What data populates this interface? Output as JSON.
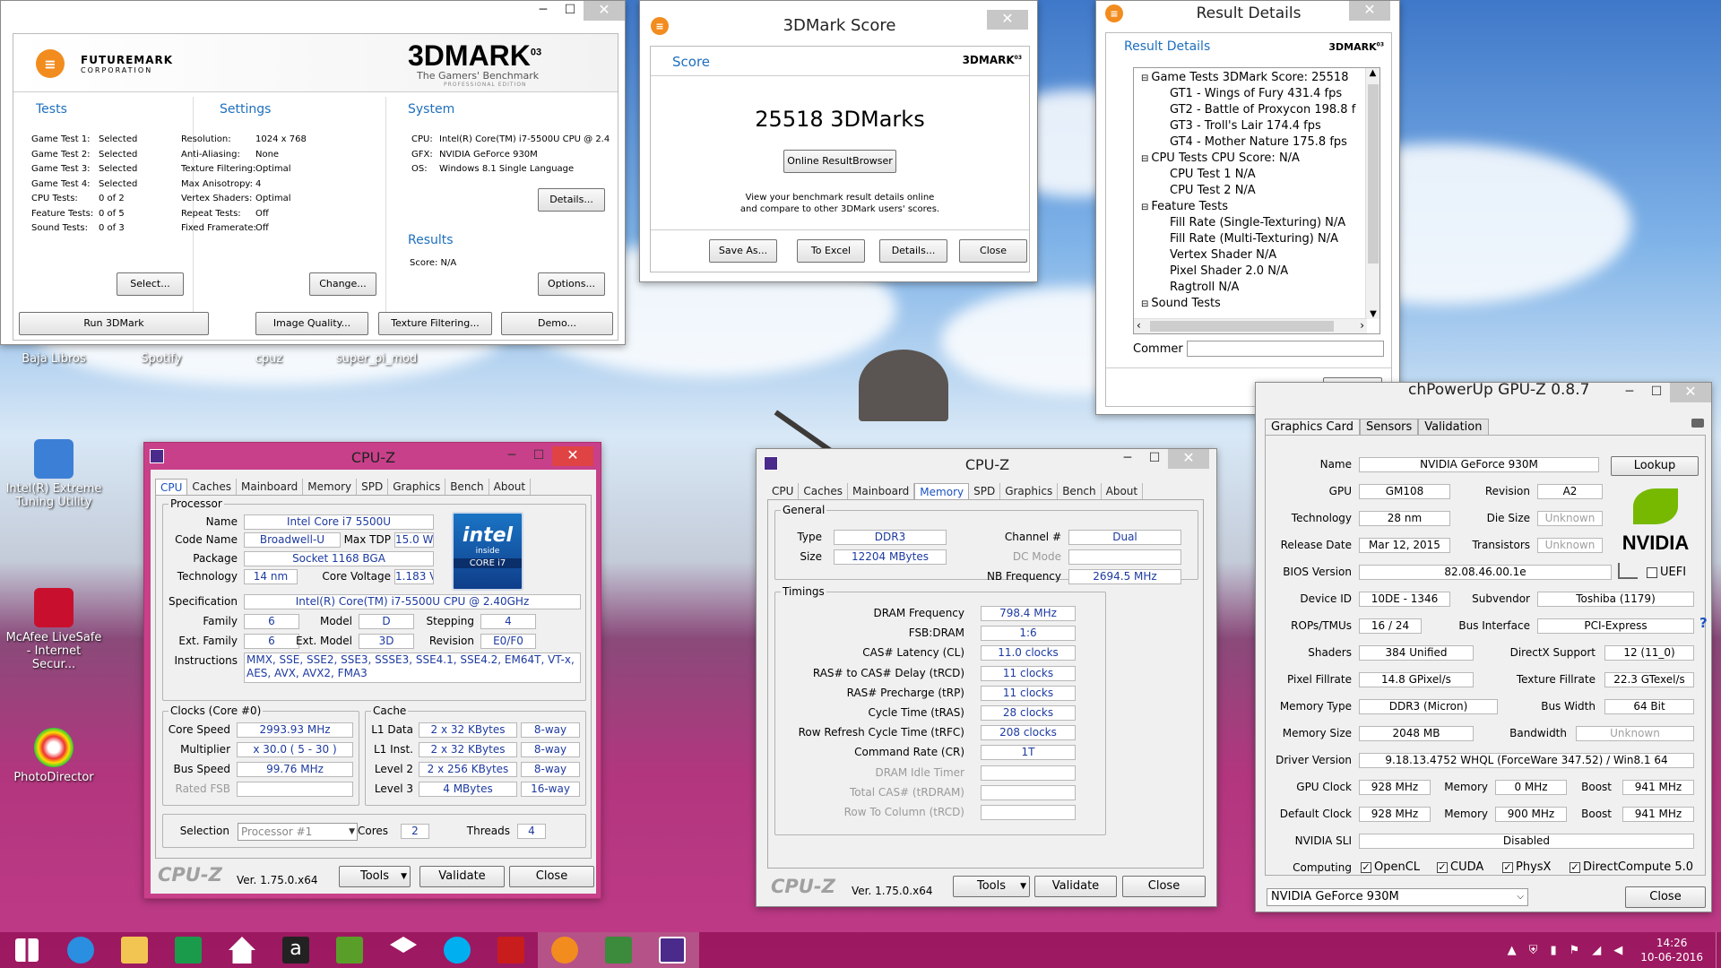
{
  "tdm": {
    "logo_line1": "FUTUREMARK",
    "logo_line2": "CORPORATION",
    "brand": "3DMARK",
    "brand_sup": "03",
    "tagline": "The Gamers' Benchmark",
    "edition": "PROFESSIONAL EDITION",
    "tests_title": "Tests",
    "settings_title": "Settings",
    "system_title": "System",
    "results_title": "Results",
    "tests": [
      [
        "Game Test 1:",
        "Selected"
      ],
      [
        "Game Test 2:",
        "Selected"
      ],
      [
        "Game Test 3:",
        "Selected"
      ],
      [
        "Game Test 4:",
        "Selected"
      ],
      [
        "CPU Tests:",
        "0 of 2"
      ],
      [
        "Feature Tests:",
        "0 of 5"
      ],
      [
        "Sound Tests:",
        "0 of 3"
      ]
    ],
    "settings": [
      [
        "Resolution:",
        "1024 x 768"
      ],
      [
        "Anti-Aliasing:",
        "None"
      ],
      [
        "Texture Filtering:",
        "Optimal"
      ],
      [
        "Max Anisotropy:",
        "4"
      ],
      [
        "Vertex Shaders:",
        "Optimal"
      ],
      [
        "Repeat Tests:",
        "Off"
      ],
      [
        "Fixed Framerate:",
        "Off"
      ]
    ],
    "system": [
      [
        "CPU:",
        "Intel(R) Core(TM) i7-5500U CPU @ 2.40"
      ],
      [
        "GFX:",
        "NVIDIA GeForce 930M"
      ],
      [
        "OS:",
        "Windows 8.1 Single Language"
      ]
    ],
    "results_score": "Score: N/A",
    "btn_details": "Details...",
    "btn_select": "Select...",
    "btn_change": "Change...",
    "btn_options": "Options...",
    "btn_run": "Run 3DMark",
    "btn_iq": "Image Quality...",
    "btn_tf": "Texture Filtering...",
    "btn_demo": "Demo..."
  },
  "score": {
    "window_title": "3DMark Score",
    "header": "Score",
    "brand": "3DMARK",
    "brand_sup": "03",
    "value": "25518 3DMarks",
    "btn_online": "Online ResultBrowser",
    "desc1": "View your benchmark result details online",
    "desc2": "and compare to other 3DMark users' scores.",
    "btn_save": "Save As...",
    "btn_excel": "To Excel",
    "btn_details": "Details...",
    "btn_close": "Close"
  },
  "result": {
    "window_title": "Result Details",
    "header": "Result Details",
    "brand": "3DMARK",
    "brand_sup": "03",
    "tree": [
      {
        "t": "Game Tests   3DMark Score: 25518",
        "l": 0,
        "e": "⊟"
      },
      {
        "t": "GT1 - Wings of Fury   431.4 fps",
        "l": 1
      },
      {
        "t": "GT2 - Battle of Proxycon   198.8 f",
        "l": 1
      },
      {
        "t": "GT3 - Troll's Lair   174.4 fps",
        "l": 1
      },
      {
        "t": "GT4 - Mother Nature   175.8 fps",
        "l": 1
      },
      {
        "t": "CPU Tests   CPU Score: N/A",
        "l": 0,
        "e": "⊟"
      },
      {
        "t": "CPU Test 1   N/A",
        "l": 1
      },
      {
        "t": "CPU Test 2   N/A",
        "l": 1
      },
      {
        "t": "Feature Tests",
        "l": 0,
        "e": "⊟"
      },
      {
        "t": "Fill Rate (Single-Texturing)   N/A",
        "l": 1
      },
      {
        "t": "Fill Rate (Multi-Texturing)   N/A",
        "l": 1
      },
      {
        "t": "Vertex Shader   N/A",
        "l": 1
      },
      {
        "t": "Pixel Shader 2.0   N/A",
        "l": 1
      },
      {
        "t": "Ragtroll   N/A",
        "l": 1
      },
      {
        "t": "Sound Tests",
        "l": 0,
        "e": "⊟"
      }
    ],
    "comment_label": "Commer",
    "btn_close": "Close"
  },
  "cpuz1": {
    "window_title": "CPU-Z",
    "tabs": [
      "CPU",
      "Caches",
      "Mainboard",
      "Memory",
      "SPD",
      "Graphics",
      "Bench",
      "About"
    ],
    "processor_title": "Processor",
    "name_l": "Name",
    "name": "Intel Core i7 5500U",
    "codename_l": "Code Name",
    "codename": "Broadwell-U",
    "maxtdp_l": "Max TDP",
    "maxtdp": "15.0 W",
    "package_l": "Package",
    "package": "Socket 1168 BGA",
    "tech_l": "Technology",
    "tech": "14 nm",
    "cv_l": "Core Voltage",
    "cv": "1.183 V",
    "spec_l": "Specification",
    "spec": "Intel(R) Core(TM) i7-5500U CPU @ 2.40GHz",
    "family_l": "Family",
    "family": "6",
    "model_l": "Model",
    "model": "D",
    "stepping_l": "Stepping",
    "stepping": "4",
    "extfam_l": "Ext. Family",
    "extfam": "6",
    "extmodel_l": "Ext. Model",
    "extmodel": "3D",
    "rev_l": "Revision",
    "rev": "E0/F0",
    "instr_l": "Instructions",
    "instr1": "MMX, SSE, SSE2, SSE3, SSSE3, SSE4.1, SSE4.2, EM64T, VT-x,",
    "instr2": "AES, AVX, AVX2, FMA3",
    "intel_1": "intel",
    "intel_2": "inside",
    "intel_3": "CORE i7",
    "clocks_title": "Clocks (Core #0)",
    "cs_l": "Core Speed",
    "cs": "2993.93 MHz",
    "mul_l": "Multiplier",
    "mul": "x 30.0 ( 5 - 30 )",
    "bus_l": "Bus Speed",
    "bus": "99.76 MHz",
    "fsb_l": "Rated FSB",
    "cache_title": "Cache",
    "l1d_l": "L1 Data",
    "l1d": "2 x 32 KBytes",
    "l1d_w": "8-way",
    "l1i_l": "L1 Inst.",
    "l1i": "2 x 32 KBytes",
    "l1i_w": "8-way",
    "l2_l": "Level 2",
    "l2": "2 x 256 KBytes",
    "l2_w": "8-way",
    "l3_l": "Level 3",
    "l3": "4 MBytes",
    "l3_w": "16-way",
    "sel_l": "Selection",
    "sel": "Processor #1",
    "cores_l": "Cores",
    "cores": "2",
    "threads_l": "Threads",
    "threads": "4",
    "brand": "CPU-Z",
    "ver": "Ver. 1.75.0.x64",
    "btn_tools": "Tools",
    "btn_validate": "Validate",
    "btn_close": "Close"
  },
  "cpuz2": {
    "window_title": "CPU-Z",
    "tabs": [
      "CPU",
      "Caches",
      "Mainboard",
      "Memory",
      "SPD",
      "Graphics",
      "Bench",
      "About"
    ],
    "general_title": "General",
    "type_l": "Type",
    "type": "DDR3",
    "size_l": "Size",
    "size": "12204 MBytes",
    "chan_l": "Channel #",
    "chan": "Dual",
    "dc_l": "DC Mode",
    "nb_l": "NB Frequency",
    "nb": "2694.5 MHz",
    "timings_title": "Timings",
    "timings": [
      [
        "DRAM Frequency",
        "798.4 MHz",
        false
      ],
      [
        "FSB:DRAM",
        "1:6",
        false
      ],
      [
        "CAS# Latency (CL)",
        "11.0 clocks",
        false
      ],
      [
        "RAS# to CAS# Delay (tRCD)",
        "11 clocks",
        false
      ],
      [
        "RAS# Precharge (tRP)",
        "11 clocks",
        false
      ],
      [
        "Cycle Time (tRAS)",
        "28 clocks",
        false
      ],
      [
        "Row Refresh Cycle Time (tRFC)",
        "208 clocks",
        false
      ],
      [
        "Command Rate (CR)",
        "1T",
        false
      ],
      [
        "DRAM Idle Timer",
        "",
        true
      ],
      [
        "Total CAS# (tRDRAM)",
        "",
        true
      ],
      [
        "Row To Column (tRCD)",
        "",
        true
      ]
    ],
    "brand": "CPU-Z",
    "ver": "Ver. 1.75.0.x64",
    "btn_tools": "Tools",
    "btn_validate": "Validate",
    "btn_close": "Close"
  },
  "gpuz": {
    "window_title": "chPowerUp GPU-Z 0.8.7",
    "tabs": [
      "Graphics Card",
      "Sensors",
      "Validation"
    ],
    "name_l": "Name",
    "name": "NVIDIA GeForce 930M",
    "btn_lookup": "Lookup",
    "gpu_l": "GPU",
    "gpu": "GM108",
    "rev_l": "Revision",
    "rev": "A2",
    "tech_l": "Technology",
    "tech": "28 nm",
    "die_l": "Die Size",
    "die": "Unknown",
    "rel_l": "Release Date",
    "rel": "Mar 12, 2015",
    "trans_l": "Transistors",
    "trans": "Unknown",
    "bios_l": "BIOS Version",
    "bios": "82.08.46.00.1e",
    "uefi": "UEFI",
    "dev_l": "Device ID",
    "dev": "10DE - 1346",
    "subv_l": "Subvendor",
    "subv": "Toshiba (1179)",
    "rops_l": "ROPs/TMUs",
    "rops": "16 / 24",
    "busif_l": "Bus Interface",
    "busif": "PCI-Express",
    "shaders_l": "Shaders",
    "shaders": "384 Unified",
    "dx_l": "DirectX Support",
    "dx": "12 (11_0)",
    "pix_l": "Pixel Fillrate",
    "pix": "14.8 GPixel/s",
    "tex_l": "Texture Fillrate",
    "tex": "22.3 GTexel/s",
    "mt_l": "Memory Type",
    "mt": "DDR3 (Micron)",
    "bw_l": "Bus Width",
    "bw": "64 Bit",
    "ms_l": "Memory Size",
    "ms": "2048 MB",
    "band_l": "Bandwidth",
    "band": "Unknown",
    "drv_l": "Driver Version",
    "drv": "9.18.13.4752 WHQL (ForceWare 347.52) / Win8.1 64",
    "gclk_l": "GPU Clock",
    "gclk": "928 MHz",
    "mem_l": "Memory",
    "gmem": "0 MHz",
    "boost_l": "Boost",
    "gboost": "941 MHz",
    "dclk_l": "Default Clock",
    "dclk": "928 MHz",
    "dmem": "900 MHz",
    "dboost": "941 MHz",
    "sli_l": "NVIDIA SLI",
    "sli": "Disabled",
    "comp_l": "Computing",
    "opencl": "OpenCL",
    "cuda": "CUDA",
    "physx": "PhysX",
    "dc": "DirectCompute 5.0",
    "nvidia": "NVIDIA",
    "select": "NVIDIA GeForce 930M",
    "btn_close": "Close",
    "help": "?"
  },
  "desktop": {
    "icons": [
      "Baja Libros",
      "Spotify",
      "cpuz",
      "super_pi_mod"
    ],
    "ie": "Intel(R) Extreme Tuning Utility",
    "mcafee": "McAfee LiveSafe - Internet Secur...",
    "photo": "PhotoDirector"
  },
  "taskbar": {
    "time": "14:26",
    "date": "10-06-2016"
  }
}
